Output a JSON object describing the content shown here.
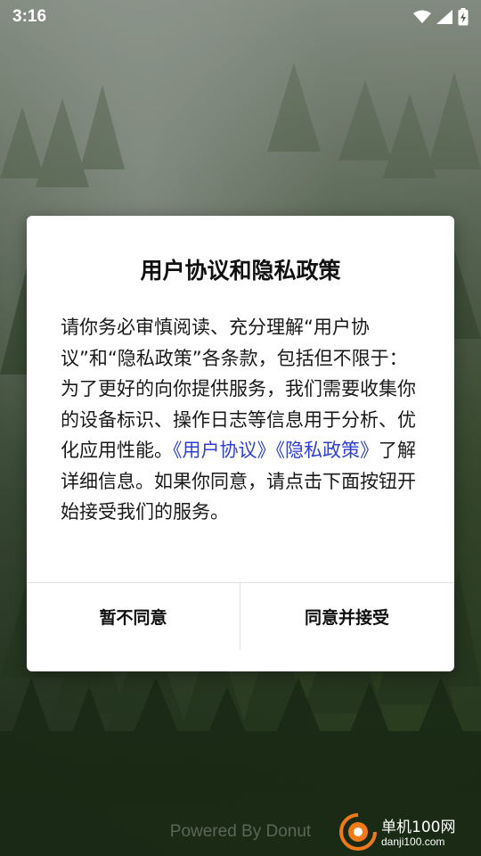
{
  "status_bar": {
    "time": "3:16",
    "icons": [
      "wifi-icon",
      "signal-icon",
      "battery-charging-icon"
    ]
  },
  "dialog": {
    "title": "用户协议和隐私政策",
    "body_before": "请你务必审慎阅读、充分理解“用户协议”和“隐私政策”各条款，包括但不限于：为了更好的向你提供服务，我们需要收集你的设备标识、操作日志等信息用于分析、优化应用性能。",
    "link_user_agreement": "《用户协议》",
    "link_privacy_policy": "《隐私政策》",
    "body_after": "了解详细信息。如果你同意，请点击下面按钮开始接受我们的服务。",
    "decline_label": "暂不同意",
    "accept_label": "同意并接受",
    "link_color": "#2f3fd6"
  },
  "footer": {
    "powered_by": "Powered By Donut"
  },
  "watermark": {
    "title": "单机100网",
    "url": "danji100.com",
    "accent_color": "#f07a1a"
  }
}
